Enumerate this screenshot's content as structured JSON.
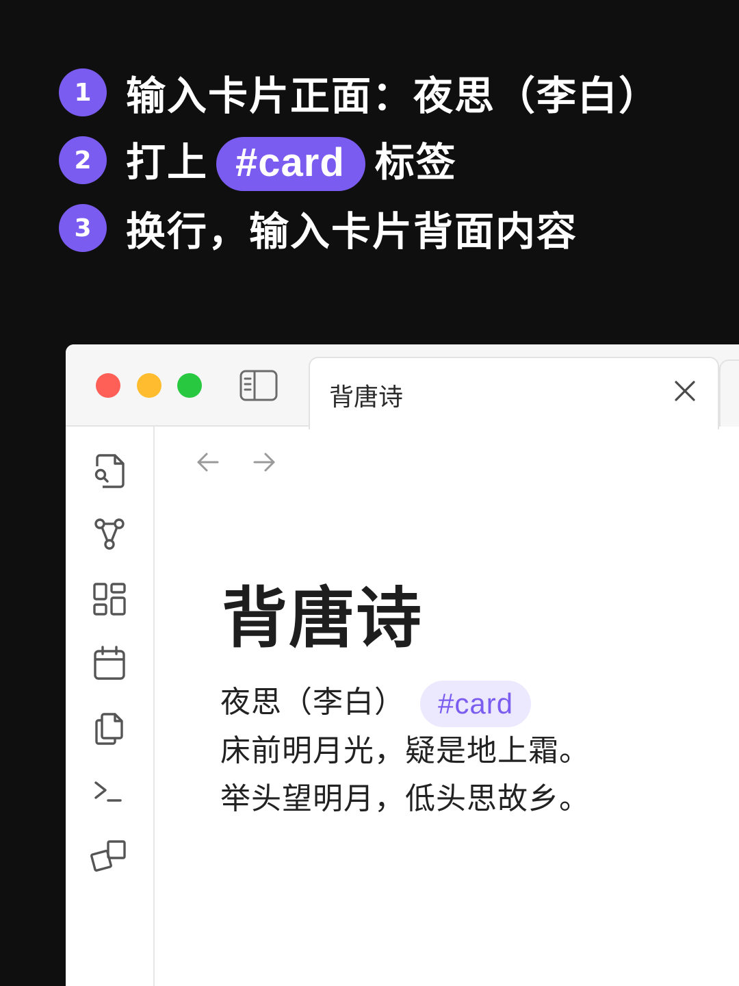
{
  "colors": {
    "accent": "#7b5cf0",
    "background": "#0f0f0f",
    "tag_bg": "#ece8fd",
    "traffic_red": "#fe5f57",
    "traffic_yellow": "#febc2e",
    "traffic_green": "#28c840"
  },
  "steps": [
    {
      "number": "1",
      "text": "输入卡片正面：夜思（李白）"
    },
    {
      "number": "2",
      "text_before": "打上",
      "tag": "#card",
      "text_after": "标签"
    },
    {
      "number": "3",
      "text": "换行，输入卡片背面内容"
    }
  ],
  "window": {
    "tab_title": "背唐诗",
    "icons": {
      "sidebar_toggle": "sidebar-toggle-icon",
      "tab_close": "close-icon",
      "back": "arrow-left-icon",
      "forward": "arrow-right-icon"
    },
    "ribbon_icons": [
      "file-search-icon",
      "graph-icon",
      "grid-icon",
      "calendar-icon",
      "copy-icon",
      "terminal-icon",
      "canvas-icon"
    ]
  },
  "note": {
    "title": "背唐诗",
    "line1_text": "夜思（李白）",
    "line1_tag": "#card",
    "line2": "床前明月光，疑是地上霜。",
    "line3": "举头望明月，低头思故乡。"
  }
}
